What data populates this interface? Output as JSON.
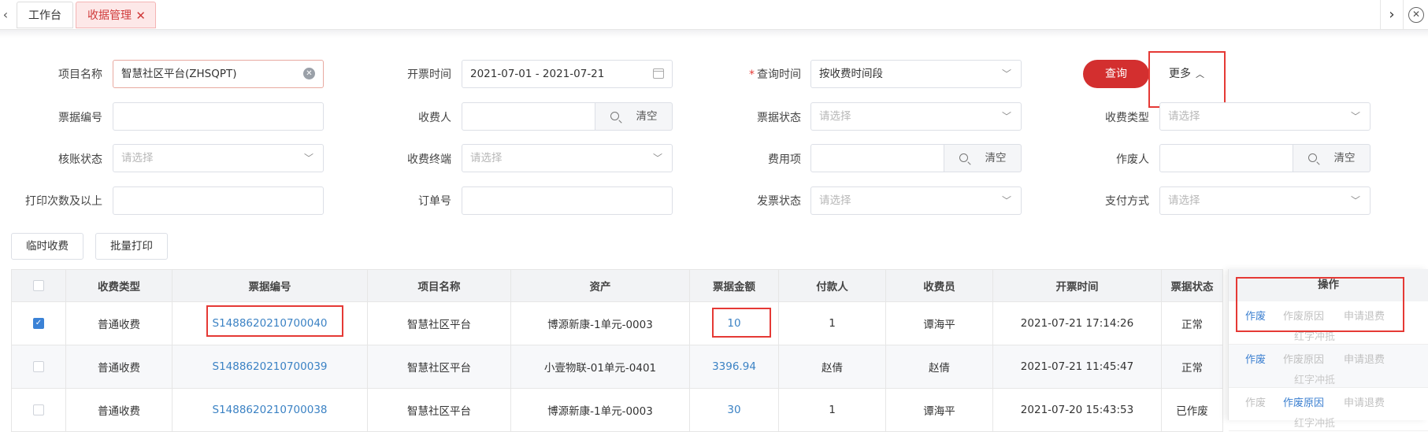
{
  "tabs": {
    "home": "工作台",
    "active": "收据管理"
  },
  "form": {
    "project_label": "项目名称",
    "project_value": "智慧社区平台(ZHSQPT)",
    "invoice_time_label": "开票时间",
    "invoice_time_value": "2021-07-01 - 2021-07-21",
    "query_time_label": "查询时间",
    "query_time_value": "按收费时间段",
    "receipt_no_label": "票据编号",
    "payee_label": "收费人",
    "receipt_status_label": "票据状态",
    "fee_type_label": "收费类型",
    "reconcile_label": "核账状态",
    "terminal_label": "收费终端",
    "fee_item_label": "费用项",
    "voider_label": "作废人",
    "print_count_label": "打印次数及以上",
    "order_no_label": "订单号",
    "invoice_status_label": "发票状态",
    "pay_method_label": "支付方式",
    "placeholder": "请选择",
    "clear": "清空",
    "query_button": "查询",
    "more_button": "更多"
  },
  "actions": {
    "temp_charge": "临时收费",
    "batch_print": "批量打印"
  },
  "table": {
    "headers": [
      "收费类型",
      "票据编号",
      "项目名称",
      "资产",
      "票据金额",
      "付款人",
      "收费员",
      "开票时间",
      "票据状态"
    ],
    "ops_header": "操作",
    "rows": [
      {
        "type": "普通收费",
        "no": "S1488620210700040",
        "project": "智慧社区平台",
        "asset": "博源新康-1单元-0003",
        "amount": "10",
        "payer": "1",
        "cashier": "谭海平",
        "time": "2021-07-21 17:14:26",
        "status": "正常",
        "checked": true
      },
      {
        "type": "普通收费",
        "no": "S1488620210700039",
        "project": "智慧社区平台",
        "asset": "小壹物联-01单元-0401",
        "amount": "3396.94",
        "payer": "赵倩",
        "cashier": "赵倩",
        "time": "2021-07-21 11:45:47",
        "status": "正常",
        "checked": false
      },
      {
        "type": "普通收费",
        "no": "S1488620210700038",
        "project": "智慧社区平台",
        "asset": "博源新康-1单元-0003",
        "amount": "30",
        "payer": "1",
        "cashier": "谭海平",
        "time": "2021-07-20 15:43:53",
        "status": "已作废",
        "checked": false
      }
    ],
    "ops": {
      "void": "作废",
      "void_reason": "作废原因",
      "refund": "申请退费",
      "red_offset": "红字冲抵"
    }
  },
  "colors": {
    "accent": "#d32f2f",
    "link": "#3b82c4",
    "highlight_box": "#e53935"
  }
}
